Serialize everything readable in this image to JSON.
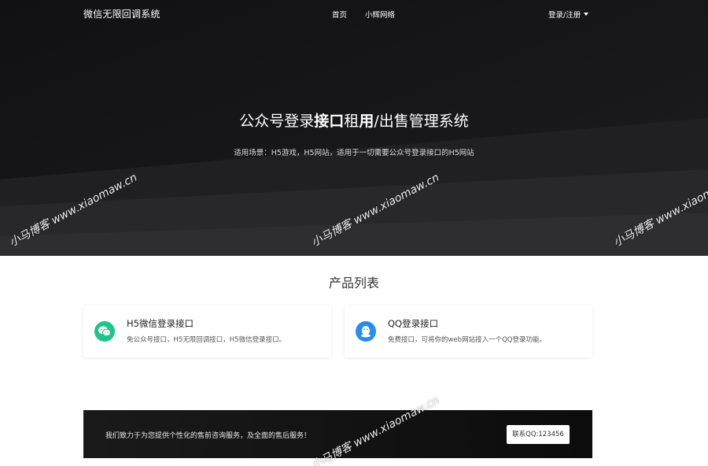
{
  "nav": {
    "brand": "微信无限回调系统",
    "links": [
      "首页",
      "小辉网络"
    ],
    "login": "登录/注册"
  },
  "hero": {
    "title_parts": [
      "公众号登录",
      "接口",
      "租",
      "用",
      "/出售管理系统"
    ],
    "subtitle": "适用场景：H5游戏，H5网站，适用于一切需要公众号登录接口的H5网站"
  },
  "products": {
    "title": "产品列表",
    "items": [
      {
        "name": "H5微信登录接口",
        "desc": "免公众号接口，H5无限回调接口，H5微信登录接口。",
        "icon": "wechat-icon",
        "color": "#20c38b"
      },
      {
        "name": "QQ登录接口",
        "desc": "免费接口，可将你的web网站接入一个QQ登录功能。",
        "icon": "qq-icon",
        "color": "#2a8cf0"
      }
    ]
  },
  "cta": {
    "text": "我们致力于为您提供个性化的售前咨询服务，及全面的售后服务！",
    "button": "联系QQ:123456"
  },
  "watermark": "小马博客 www.xiaomaw.cn"
}
